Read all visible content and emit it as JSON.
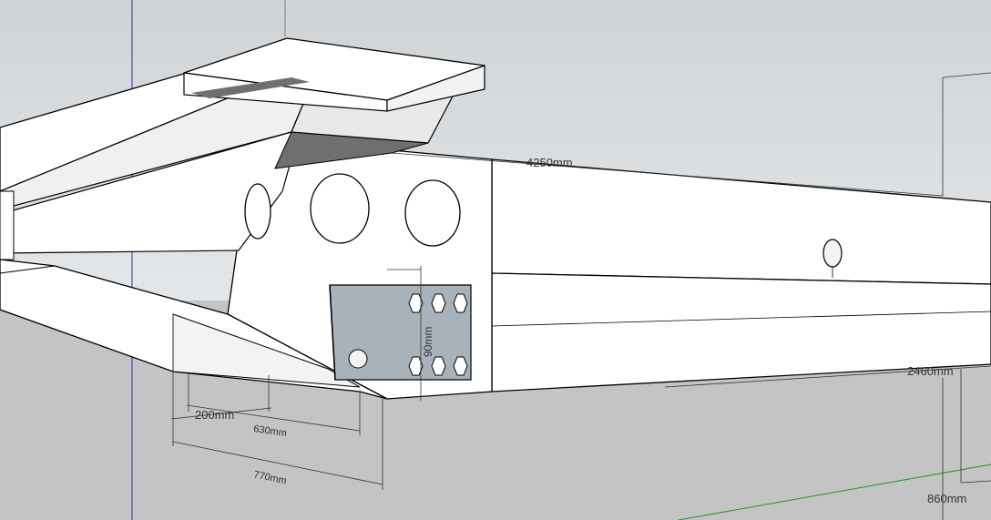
{
  "app": {
    "name": "SketchUp 3D modeling viewport"
  },
  "colors": {
    "sky_top": "#cfd3d6",
    "sky_bottom": "#e3e6e8",
    "ground": "#c4c4c4",
    "face_white": "#ffffff",
    "face_light": "#f3f3f3",
    "face_shadow": "#6f6f6f",
    "plate": "#a8b2ba",
    "edge": "#000000",
    "blue_axis": "#1f2fb0",
    "green_axis": "#1a9a1a"
  },
  "dimensions": {
    "length_top": "4250mm",
    "height_plate": "90mm",
    "offset_200": "200mm",
    "offset_630": "630mm",
    "offset_770": "770mm",
    "width_2460": "2460mm",
    "height_860": "860mm"
  }
}
